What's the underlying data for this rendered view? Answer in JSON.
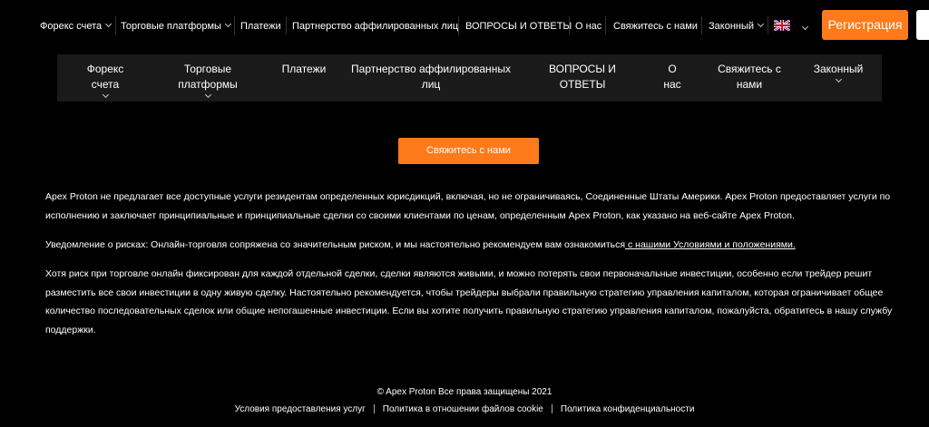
{
  "topnav": {
    "forex": "Форекс счета",
    "platforms": "Торговые платформы",
    "payments": "Платежи",
    "affiliate": "Партнерство аффилированных лиц",
    "faq": "ВОПРОСЫ И ОТВЕТЫ",
    "about": "О нас",
    "contact": "Свяжитесь с нами",
    "legal": "Законный",
    "register": "Регистрация"
  },
  "subnav": {
    "forex_line1": "Форекс",
    "forex_line2": "счета",
    "platforms_line1": "Торговые",
    "platforms_line2": "платформы",
    "payments": "Платежи",
    "affiliate_line1": "Партнерство аффилированных",
    "affiliate_line2": "лиц",
    "faq_line1": "ВОПРОСЫ И",
    "faq_line2": "ОТВЕТЫ",
    "about_line1": "О",
    "about_line2": "нас",
    "contact_line1": "Свяжитесь с",
    "contact_line2": "нами",
    "legal": "Законный"
  },
  "contact_button": "Свяжитесь с нами",
  "disclaimer": {
    "p1": "Apex Proton не предлагает все доступные услуги резидентам определенных юрисдикций, включая, но не ограничиваясь, Соединенные Штаты Америки. Apex Proton предоставляет услуги по исполнению и заключает принципиальные и принципиальные сделки со своими клиентами по ценам, определенным Apex Proton, как указано на веб-сайте Apex Proton.",
    "p2_text": "Уведомление о рисках: Онлайн-торговля сопряжена со значительным риском, и мы настоятельно рекомендуем вам ознакомиться",
    "p2_link": " с нашими Условиями и положениями.",
    "p3": "Хотя риск при торговле онлайн фиксирован для каждой отдельной сделки, сделки являются живыми, и можно потерять свои первоначальные инвестиции, особенно если трейдер решит разместить все свои инвестиции в одну живую сделку. Настоятельно рекомендуется, чтобы трейдеры выбрали правильную стратегию управления капиталом, которая ограничивает общее количество последовательных сделок или общие непогашенные инвестиции. Если вы хотите получить правильную стратегию управления капиталом, пожалуйста, обратитесь в нашу службу поддержки."
  },
  "footer": {
    "copyright": "© Apex Proton Все права защищены 2021",
    "terms": "Условия предоставления услуг",
    "cookies": "Политика в отношении файлов cookie",
    "privacy": "Политика конфиденциальности"
  },
  "icons": {
    "flag": "uk-flag-icon",
    "chevron": "chevron-down-icon"
  },
  "colors": {
    "accent": "#ff7a1a",
    "background": "#000000",
    "subnav_bg": "#1a1a1a"
  }
}
